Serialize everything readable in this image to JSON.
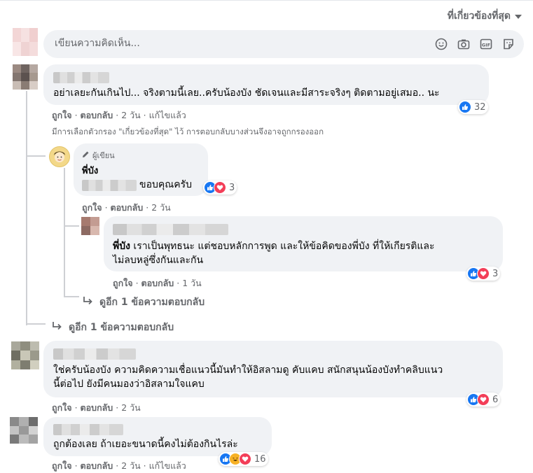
{
  "header": {
    "sort_label": "ที่เกี่ยวข้องที่สุด"
  },
  "composer": {
    "placeholder": "เขียนความคิดเห็น..."
  },
  "filter_note": "มีการเลือกตัวกรอง \"เกี่ยวข้องที่สุด\" ไว้ การตอบกลับบางส่วนจึงอาจถูกกรองออก",
  "comments": [
    {
      "text": "อย่าเลยะกันเกินไป... จริงตามนี้เลย..ครับน้องบัง ชัดเจนและมีสาระจริงๆ ติดตามอยู่เสมอ.. นะ",
      "like": "ถูกใจ",
      "reply": "ตอบกลับ",
      "time": "2 วัน",
      "edited": "แก้ไขแล้ว",
      "reaction_count": "32"
    },
    {
      "author_badge": "ผู้เขียน",
      "author_name": "พี่บัง",
      "text": "ขอบคุณครับ",
      "like": "ถูกใจ",
      "reply": "ตอบกลับ",
      "time": "2 วัน",
      "reaction_count": "3"
    },
    {
      "mention": "พี่บัง",
      "text_line1": " เราเป็นพุทธนะ แต่ชอบหลักการพูด และให้ข้อคิดของพี่บัง ที่ให้เกียรติและ",
      "text_line2": "ไม่ลบหลู่ซึ่งกันและกัน",
      "like": "ถูกใจ",
      "reply": "ตอบกลับ",
      "time": "1 วัน",
      "reaction_count": "3"
    },
    {
      "text_line1": "ใช่ครับน้องบัง ความคิดความเชื่อแนวนี้มันทำให้อิสลามดู คับแคบ สนักสนุนน้องบังทำคลิบแนว",
      "text_line2": "นี้ต่อไป ยังมีคนมองว่าอิสลามใจแคบ",
      "like": "ถูกใจ",
      "reply": "ตอบกลับ",
      "time": "2 วัน",
      "reaction_count": "6"
    },
    {
      "text": "ถูกต้องเลย ถ้าเยอะขนาดนี้คงไม่ต้องกินไรล่ะ",
      "like": "ถูกใจ",
      "reply": "ตอบกลับ",
      "time": "2 วัน",
      "edited": "แก้ไขแล้ว",
      "reaction_count": "16"
    }
  ],
  "more_replies_inner": "ดูอีก 1 ข้อความตอบกลับ",
  "more_replies_outer": "ดูอีก 1 ข้อความตอบกลับ",
  "colors": {
    "like": "#1877f2",
    "love": "#f33e58",
    "haha": "#f7b125",
    "bubble": "#f0f2f5",
    "meta": "#65676b"
  }
}
